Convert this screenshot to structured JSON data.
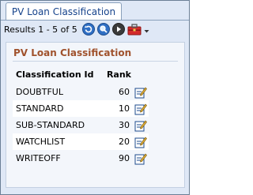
{
  "window": {
    "tab_label": "PV Loan Classification"
  },
  "toolbar": {
    "results_text": "Results 1 - 5 of 5",
    "icons": [
      "refresh-icon",
      "search-icon",
      "next-icon",
      "toolbox-icon",
      "dropdown-arrow-icon"
    ]
  },
  "panel": {
    "title": "PV Loan Classification",
    "columns": {
      "id": "Classification Id",
      "rank": "Rank"
    },
    "rows": [
      {
        "id": "DOUBTFUL",
        "rank": "60"
      },
      {
        "id": "STANDARD",
        "rank": "10"
      },
      {
        "id": "SUB-STANDARD",
        "rank": "30"
      },
      {
        "id": "WATCHLIST",
        "rank": "20"
      },
      {
        "id": "WRITEOFF",
        "rank": "90"
      }
    ]
  },
  "colors": {
    "title": "#a0522d",
    "tab_text": "#15428b",
    "background": "#dfe8f6"
  }
}
